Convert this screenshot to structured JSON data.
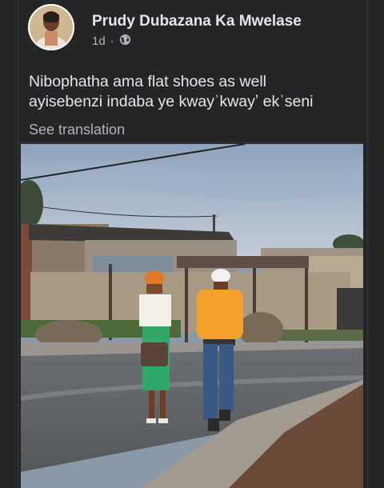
{
  "post": {
    "author": "Prudy Dubazana Ka Mwelase",
    "time": "1d",
    "separator": "·",
    "audience_icon": "globe-icon",
    "text_line1": "Nibophatha ama flat shoes as well",
    "text_line2": "ayisebenzi indaba ye kwayʾkwayʼ ekʾseni",
    "see_translation": "See translation"
  },
  "colors": {
    "background": "#242526",
    "primary_text": "#e4e6eb",
    "secondary_text": "#b0b3b8"
  }
}
